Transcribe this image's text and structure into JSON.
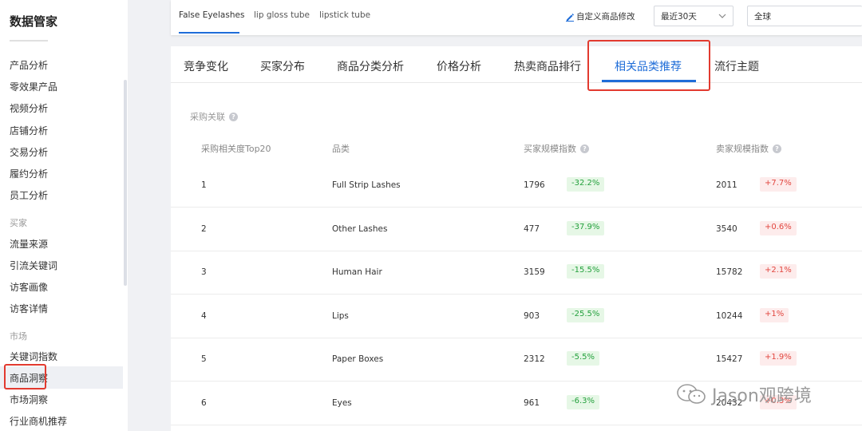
{
  "sidebar": {
    "title": "数据管家",
    "items_top": [
      "产品分析",
      "零效果产品",
      "视频分析",
      "店铺分析",
      "交易分析",
      "履约分析",
      "员工分析"
    ],
    "section_buyer": "买家",
    "items_buyer": [
      "流量来源",
      "引流关键词",
      "访客画像",
      "访客详情"
    ],
    "section_market": "市场",
    "items_market": [
      "关键词指数",
      "商品洞察",
      "市场洞察",
      "行业商机推荐"
    ]
  },
  "topbar": {
    "tabs": [
      "False Eyelashes",
      "lip gloss tube",
      "lipstick tube"
    ],
    "edit_label": "自定义商品修改",
    "date_select": "最近30天",
    "region_select": "全球"
  },
  "tabs": [
    "竞争变化",
    "买家分布",
    "商品分类分析",
    "价格分析",
    "热卖商品排行",
    "相关品类推荐",
    "流行主题"
  ],
  "section": {
    "label": "采购关联"
  },
  "table": {
    "headers": [
      "采购相关度Top20",
      "品类",
      "买家规模指数",
      "卖家规模指数"
    ],
    "rows": [
      {
        "rank": "1",
        "category": "Full Strip Lashes",
        "buyer": "1796",
        "buyer_change": "-32.2%",
        "seller": "2011",
        "seller_change": "+7.7%"
      },
      {
        "rank": "2",
        "category": "Other Lashes",
        "buyer": "477",
        "buyer_change": "-37.9%",
        "seller": "3540",
        "seller_change": "+0.6%"
      },
      {
        "rank": "3",
        "category": "Human Hair",
        "buyer": "3159",
        "buyer_change": "-15.5%",
        "seller": "15782",
        "seller_change": "+2.1%"
      },
      {
        "rank": "4",
        "category": "Lips",
        "buyer": "903",
        "buyer_change": "-25.5%",
        "seller": "10244",
        "seller_change": "+1%"
      },
      {
        "rank": "5",
        "category": "Paper Boxes",
        "buyer": "2312",
        "buyer_change": "-5.5%",
        "seller": "15427",
        "seller_change": "+1.9%"
      },
      {
        "rank": "6",
        "category": "Eyes",
        "buyer": "961",
        "buyer_change": "-6.3%",
        "seller": "20432",
        "seller_change": "+0.3%"
      }
    ]
  },
  "watermark": {
    "text": "Jason观跨境"
  },
  "colors": {
    "accent": "#1f6dd8",
    "highlight": "#e23a2f",
    "down": "#23a03c",
    "up": "#e2463f"
  }
}
